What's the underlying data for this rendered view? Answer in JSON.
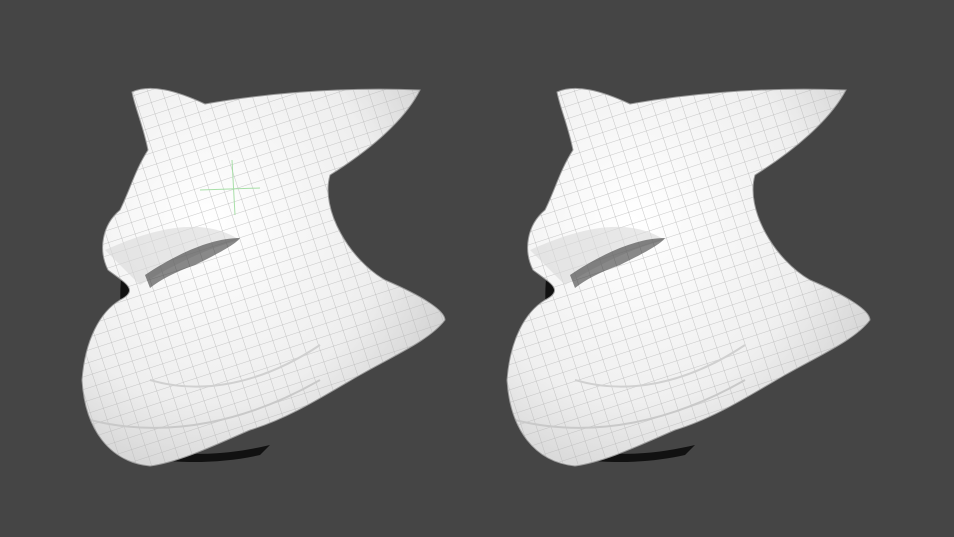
{
  "scene": {
    "background_color": "#454545",
    "mesh_fill_color": "#f2f2f2",
    "wire_color": "#b9b9b9",
    "shadow_color": "#111111",
    "left_model": {
      "selected_edge_color": "#9fdc9f"
    },
    "right_model": {}
  }
}
